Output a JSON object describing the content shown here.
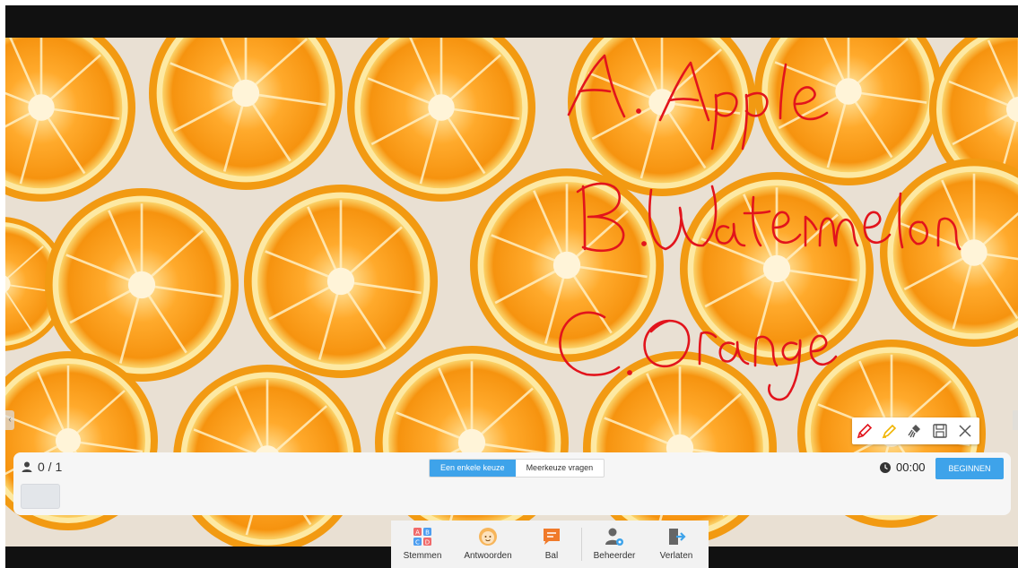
{
  "board": {
    "handwriting": [
      "A. Apple",
      "B. Watermelon",
      "C. Orange"
    ],
    "ink_color": "#e2141c"
  },
  "pen_toolbar": {
    "tools": [
      {
        "icon": "pencil-icon"
      },
      {
        "icon": "highlighter-icon"
      },
      {
        "icon": "brush-eraser-icon"
      },
      {
        "icon": "save-icon"
      },
      {
        "icon": "close-icon"
      }
    ]
  },
  "vote_panel": {
    "participants": "0 / 1",
    "tabs": [
      "Een enkele keuze",
      "Meerkeuze vragen"
    ],
    "active_tab": 0,
    "timer": "00:00",
    "start_label": "BEGINNEN",
    "accent": "#3ea3ea"
  },
  "bottom_bar": {
    "items": [
      {
        "label": "Stemmen",
        "icon": "abcd-vote-icon"
      },
      {
        "label": "Antwoorden",
        "icon": "smiley-answer-icon"
      },
      {
        "label": "Bal",
        "icon": "chat-bubble-icon"
      },
      {
        "label": "Beheerder",
        "icon": "admin-user-gear-icon"
      },
      {
        "label": "Verlaten",
        "icon": "exit-icon"
      }
    ]
  }
}
